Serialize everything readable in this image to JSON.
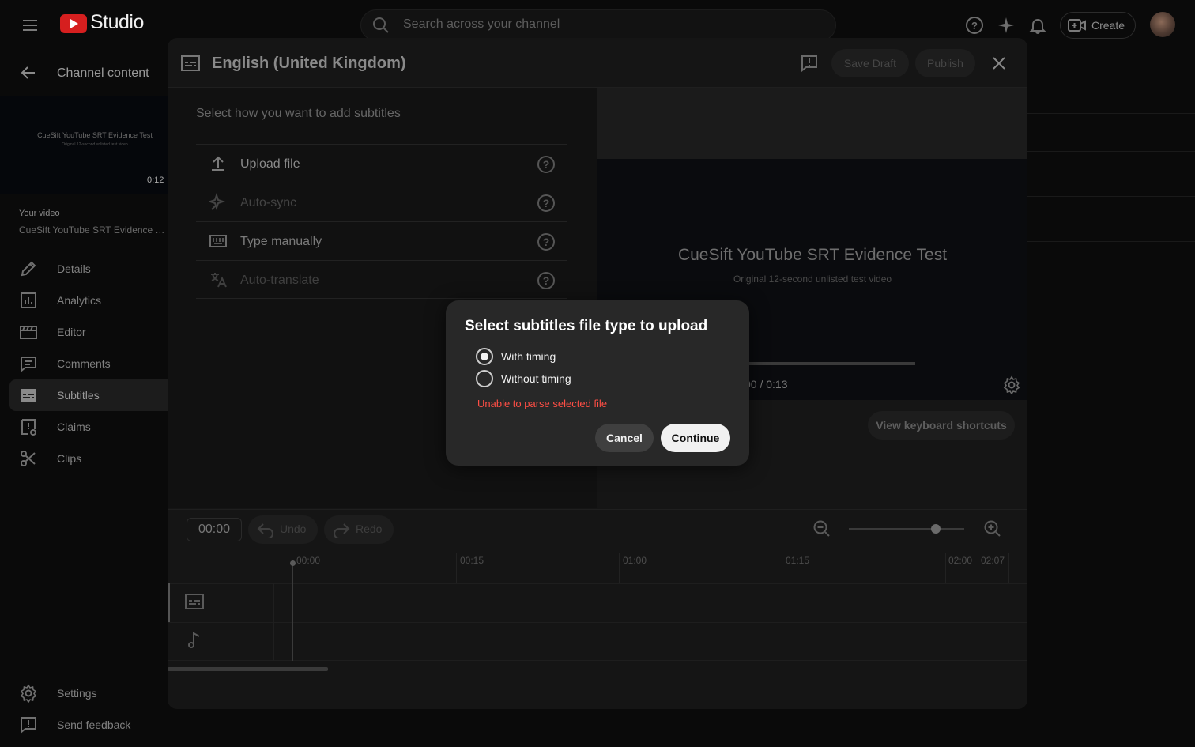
{
  "topbar": {
    "logo_text": "Studio",
    "search_placeholder": "Search across your channel",
    "create_label": "Create"
  },
  "sidebar": {
    "back_title": "Channel content",
    "thumbnail": {
      "title": "CueSift YouTube SRT Evidence Test",
      "subtitle": "Original 12-second unlisted test video",
      "duration": "0:12"
    },
    "your_video_label": "Your video",
    "video_name": "CueSift YouTube SRT Evidence Test",
    "nav": [
      {
        "label": "Details",
        "icon": "pencil-icon"
      },
      {
        "label": "Analytics",
        "icon": "analytics-icon"
      },
      {
        "label": "Editor",
        "icon": "clapperboard-icon"
      },
      {
        "label": "Comments",
        "icon": "comment-icon"
      },
      {
        "label": "Subtitles",
        "icon": "subtitles-icon",
        "active": true
      },
      {
        "label": "Claims",
        "icon": "claims-icon"
      },
      {
        "label": "Clips",
        "icon": "scissors-icon"
      }
    ],
    "settings_label": "Settings",
    "feedback_label": "Send feedback"
  },
  "editor": {
    "title": "English (United Kingdom)",
    "save_draft": "Save Draft",
    "publish": "Publish",
    "select_how": "Select how you want to add subtitles",
    "options": [
      {
        "label": "Upload file",
        "icon": "upload-icon",
        "enabled": true
      },
      {
        "label": "Auto-sync",
        "icon": "auto-sync-icon",
        "enabled": false
      },
      {
        "label": "Type manually",
        "icon": "keyboard-icon",
        "enabled": true
      },
      {
        "label": "Auto-translate",
        "icon": "translate-icon",
        "enabled": false
      }
    ],
    "video": {
      "title": "CueSift YouTube SRT Evidence Test",
      "subtitle": "Original 12-second unlisted test video",
      "time": "00 / 0:13"
    },
    "keyboard_shortcuts": "View keyboard shortcuts",
    "timeline": {
      "current_time": "00:00",
      "undo": "Undo",
      "redo": "Redo",
      "zoom_level": 0.75,
      "ruler": [
        "00:00",
        "00:15",
        "01:00",
        "01:15",
        "02:00",
        "02:07"
      ]
    }
  },
  "dialog": {
    "title": "Select subtitles file type to upload",
    "options": [
      {
        "label": "With timing",
        "checked": true
      },
      {
        "label": "Without timing",
        "checked": false
      }
    ],
    "error": "Unable to parse selected file",
    "cancel": "Cancel",
    "continue": "Continue"
  },
  "colors": {
    "accent_red": "#ff4e45",
    "logo_red": "#d61f1f"
  }
}
